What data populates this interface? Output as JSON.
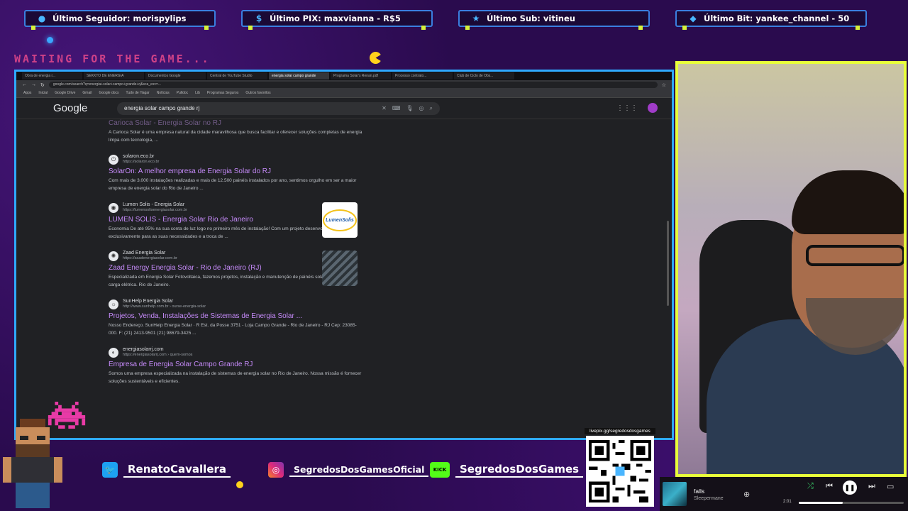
{
  "alerts": [
    {
      "icon": "user-icon",
      "text": "Último Seguidor: morispylips"
    },
    {
      "icon": "pix-icon",
      "text": "Último PIX: maxvianna - R$5"
    },
    {
      "icon": "star-icon",
      "text": "Último Sub: vitineu"
    },
    {
      "icon": "diamond-icon",
      "text": "Último Bit: yankee_channel - 50"
    }
  ],
  "overlay": {
    "waiting": "WAITING FOR THE GAME..."
  },
  "browser": {
    "tabs": [
      "Obra de energia r...",
      "SEKKTO DE ENERGIA",
      "Documentos Google",
      "Central de YouTube Studio",
      "energia solar campo grande",
      "Programa Solar's Renan.pdf",
      "Processo contrato...",
      "Club de Ciclo de Obs..."
    ],
    "url": "google.com/search?q=energia+solar+campo+grande+rj&sca_esv=...",
    "bookmarks": [
      "Apps",
      "Inicial",
      "Google Drive",
      "Gmail",
      "Google docs",
      "Tudo de Hagar",
      "Notícias",
      "Pulldoc",
      "Lib",
      "Programas Seguros",
      "Outros favoritos"
    ],
    "search_query": "energia solar campo grande rj",
    "logo": "Google"
  },
  "results": [
    {
      "site": "",
      "url": "",
      "title": "Carioca Solar - Energia Solar no RJ",
      "snippet": "A Carioca Solar é uma empresa natural da cidade maravilhosa que busca facilitar e oferecer soluções completas de energia limpa com tecnologia, ...",
      "fav": ""
    },
    {
      "site": "solaron.eco.br",
      "url": "https://solaron.eco.br",
      "title": "SolarOn: A melhor empresa de Energia Solar do RJ",
      "snippet": "Com mais de 3.000 instalações realizadas e mais de 12.500 painéis instalados por ano, sentimos orgulho em ser a maior empresa de energia solar do Rio de Janeiro ...",
      "fav": "⏻"
    },
    {
      "site": "Lumen Solis - Energia Solar",
      "url": "https://lumensolisenergiasolar.com.br",
      "title": "LUMEN SOLIS - Energia Solar Rio de Janeiro",
      "snippet": "Economia De até 95% na sua conta de luz logo no primeiro mês de instalação! Com um projeto desenvolvido exclusivamente para as suas necessidades e a troca de ...",
      "fav": "◉",
      "thumb": "LumenSolis"
    },
    {
      "site": "Zaad Energia Solar",
      "url": "https://zaadenergiasolar.com.br",
      "title": "Zaad Energy Energia Solar - Rio de Janeiro (RJ)",
      "snippet": "Especializada em Energia Solar Fotovoltaica, fazemos projetos, instalação e manutenção de painéis solares, aumento de carga elétrica. Rio de Janeiro.",
      "fav": "✺"
    },
    {
      "site": "SunHelp Energia Solar",
      "url": "http://www.sunhelp.com.br › ourse-energia-solar",
      "title": "Projetos, Venda, Instalações de Sistemas de Energia Solar ...",
      "snippet": "Nosso Endereço. SunHelp Energia Solar · R Est. da Posse 3751 - Loja Campo Grande - Rio de Janeiro - RJ Cep: 23085-000. F: (21) 2413-9501 (21) 98679-3425 ...",
      "fav": "☼"
    },
    {
      "site": "energiasolarrj.com",
      "url": "https://energiasolarrj.com › quem-somos",
      "title": "Empresa de Energia Solar Campo Grande RJ",
      "snippet": "Somos uma empresa especializada na instalação de sistemas de energia solar no Rio de Janeiro. Nossa missão é fornecer soluções sustentáveis e eficientes.",
      "fav": "◐"
    }
  ],
  "socials": {
    "twitter": "RenatoCavallera",
    "instagram": "SegredosDosGamesOficial",
    "kick_badge": "KICK",
    "kick": "SegredosDosGames"
  },
  "qr": {
    "url": "livepix.gg/segredosdosgames"
  },
  "player": {
    "song": "falls",
    "artist": "Sleepermane",
    "time": "2:01",
    "progress": 0.42
  }
}
